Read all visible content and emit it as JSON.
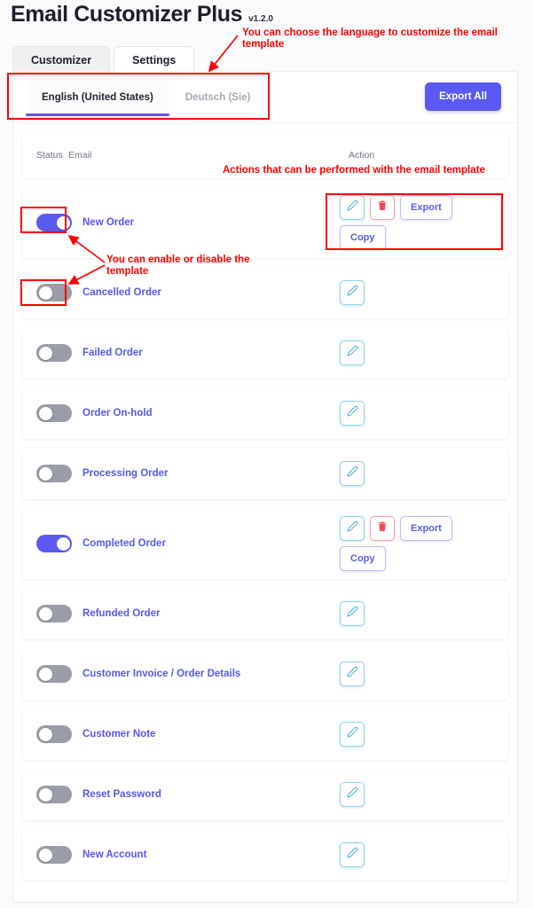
{
  "header": {
    "title": "Email Customizer Plus",
    "version": "v1.2.0"
  },
  "top_tabs": [
    {
      "label": "Customizer",
      "active": true
    },
    {
      "label": "Settings",
      "active": false
    }
  ],
  "language_tabs": [
    {
      "label": "English (United States)",
      "active": true
    },
    {
      "label": "Deutsch (Sie)",
      "active": false
    }
  ],
  "export_all_label": "Export All",
  "table": {
    "columns": {
      "status": "Status",
      "email": "Email",
      "action": "Action"
    },
    "rows": [
      {
        "name": "New Order",
        "enabled": true,
        "actions": [
          "edit",
          "delete",
          "export",
          "copy"
        ]
      },
      {
        "name": "Cancelled Order",
        "enabled": false,
        "actions": [
          "edit"
        ]
      },
      {
        "name": "Failed Order",
        "enabled": false,
        "actions": [
          "edit"
        ]
      },
      {
        "name": "Order On-hold",
        "enabled": false,
        "actions": [
          "edit"
        ]
      },
      {
        "name": "Processing Order",
        "enabled": false,
        "actions": [
          "edit"
        ]
      },
      {
        "name": "Completed Order",
        "enabled": true,
        "actions": [
          "edit",
          "delete",
          "export",
          "copy"
        ]
      },
      {
        "name": "Refunded Order",
        "enabled": false,
        "actions": [
          "edit"
        ]
      },
      {
        "name": "Customer Invoice / Order Details",
        "enabled": false,
        "actions": [
          "edit"
        ]
      },
      {
        "name": "Customer Note",
        "enabled": false,
        "actions": [
          "edit"
        ]
      },
      {
        "name": "Reset Password",
        "enabled": false,
        "actions": [
          "edit"
        ]
      },
      {
        "name": "New Account",
        "enabled": false,
        "actions": [
          "edit"
        ]
      }
    ]
  },
  "action_labels": {
    "edit": "pencil-icon",
    "delete": "trash-icon",
    "export": "Export",
    "copy": "Copy"
  },
  "annotations": [
    {
      "id": "language",
      "text": "You can choose the language to customize the email template"
    },
    {
      "id": "actions",
      "text": "Actions that can be performed with the email template"
    },
    {
      "id": "enable",
      "text": "You can enable or disable the template"
    }
  ],
  "colors": {
    "accent": "#5a5af0",
    "label": "#5757ea",
    "annotation": "#fe0000",
    "toggle_off": "#9a9da7",
    "edit_border": "#8ed4e4",
    "delete_border": "#f3a8ae",
    "text_border": "#bcbcf2"
  }
}
